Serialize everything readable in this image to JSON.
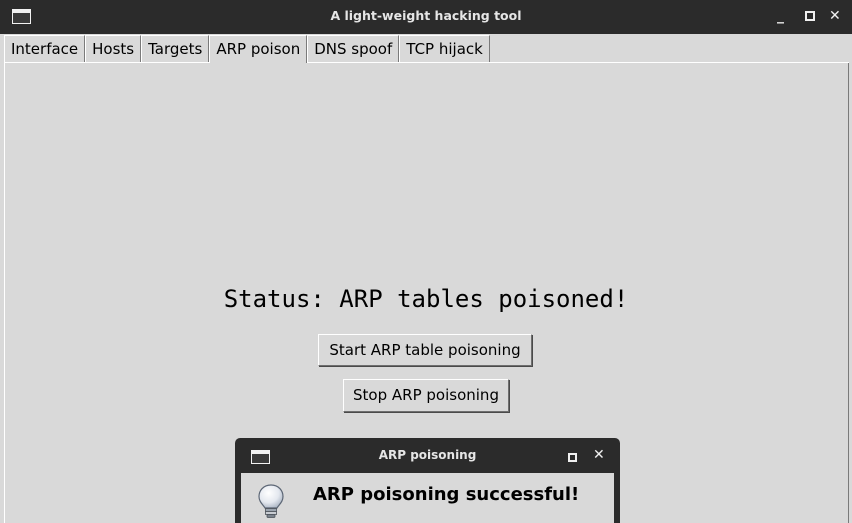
{
  "window": {
    "title": "A light-weight hacking tool",
    "minimize_label": "_",
    "close_label": "✕"
  },
  "tabs": [
    {
      "label": "Interface"
    },
    {
      "label": "Hosts"
    },
    {
      "label": "Targets"
    },
    {
      "label": "ARP poison",
      "active": true
    },
    {
      "label": "DNS spoof"
    },
    {
      "label": "TCP hijack"
    }
  ],
  "arp_panel": {
    "status_text": "Status: ARP tables poisoned!",
    "start_button": "Start ARP table poisoning",
    "stop_button": "Stop ARP poisoning"
  },
  "dialog": {
    "title": "ARP poisoning",
    "close_label": "✕",
    "message": "ARP poisoning successful!",
    "icon": "lightbulb-icon"
  }
}
